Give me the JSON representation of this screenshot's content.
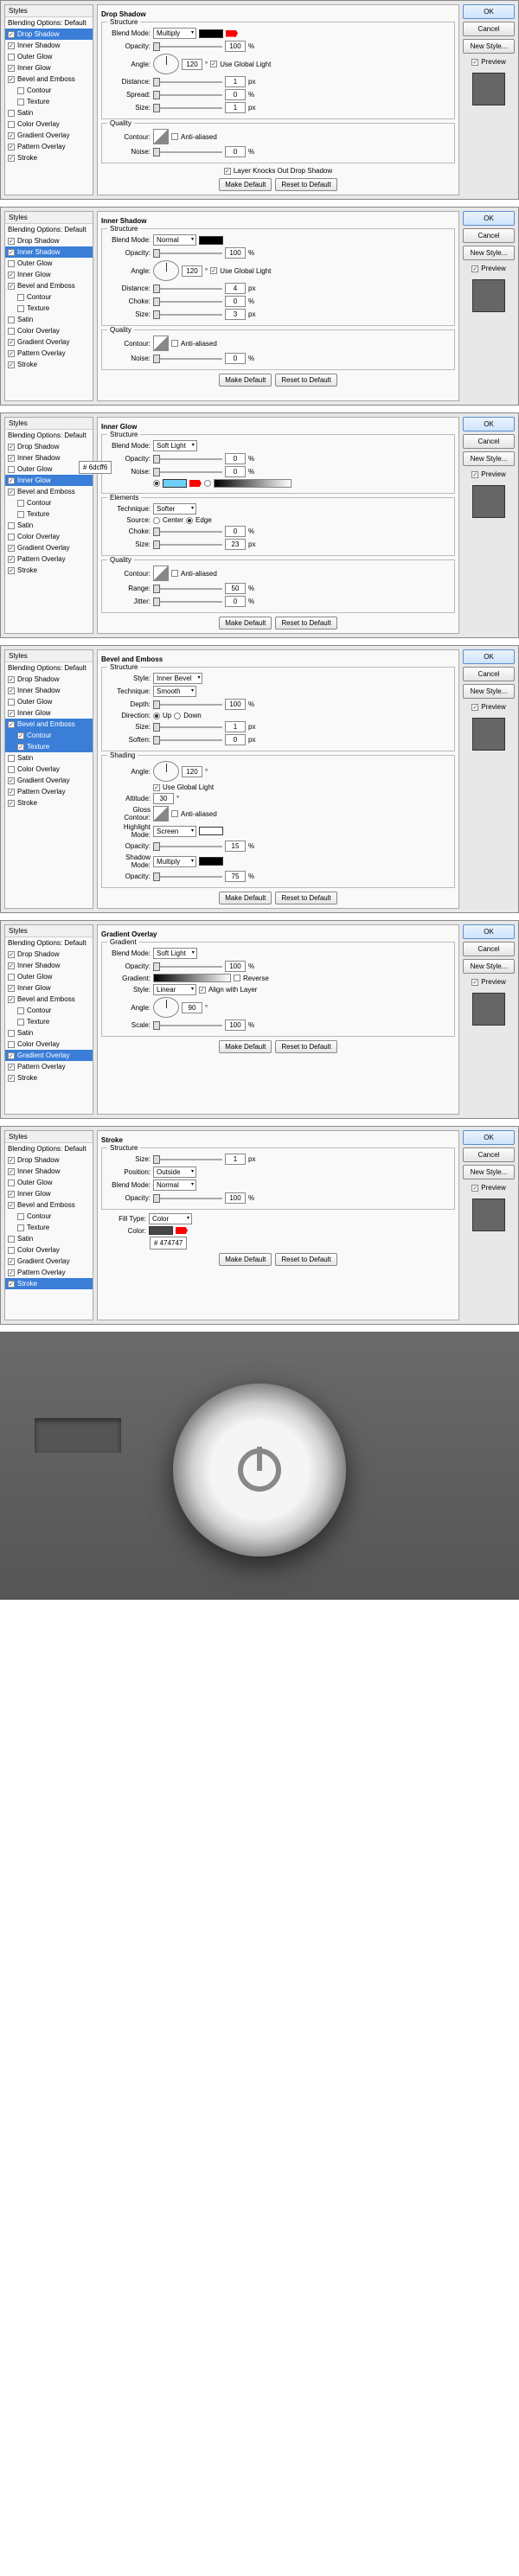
{
  "styleListHeaders": {
    "styles": "Styles",
    "blendingOptions": "Blending Options: Default"
  },
  "styleNames": {
    "dropShadow": "Drop Shadow",
    "innerShadow": "Inner Shadow",
    "outerGlow": "Outer Glow",
    "innerGlow": "Inner Glow",
    "bevelEmboss": "Bevel and Emboss",
    "contour": "Contour",
    "texture": "Texture",
    "satin": "Satin",
    "colorOverlay": "Color Overlay",
    "gradientOverlay": "Gradient Overlay",
    "patternOverlay": "Pattern Overlay",
    "stroke": "Stroke"
  },
  "buttons": {
    "ok": "OK",
    "cancel": "Cancel",
    "newStyle": "New Style...",
    "preview": "Preview",
    "makeDefault": "Make Default",
    "resetDefault": "Reset to Default"
  },
  "labels": {
    "structure": "Structure",
    "quality": "Quality",
    "elements": "Elements",
    "shading": "Shading",
    "gradient": "Gradient",
    "blendMode": "Blend Mode:",
    "opacity": "Opacity:",
    "angle": "Angle:",
    "useGlobalLight": "Use Global Light",
    "distance": "Distance:",
    "spread": "Spread:",
    "size": "Size:",
    "choke": "Choke:",
    "contour": "Contour:",
    "antiAliased": "Anti-aliased",
    "noise": "Noise:",
    "layerKnocksOut": "Layer Knocks Out Drop Shadow",
    "technique": "Technique:",
    "source": "Source:",
    "center": "Center",
    "edge": "Edge",
    "range": "Range:",
    "jitter": "Jitter:",
    "style": "Style:",
    "depth": "Depth:",
    "direction": "Direction:",
    "up": "Up",
    "down": "Down",
    "soften": "Soften:",
    "altitude": "Altitude:",
    "glossContour": "Gloss Contour:",
    "highlightMode": "Highlight Mode:",
    "shadowMode": "Shadow Mode:",
    "gradientLabel": "Gradient:",
    "reverse": "Reverse",
    "alignWithLayer": "Align with Layer",
    "scale": "Scale:",
    "position": "Position:",
    "fillType": "Fill Type:",
    "color": "Color:",
    "px": "px",
    "pct": "%",
    "deg": "°"
  },
  "dialogs": [
    {
      "id": "dropShadow",
      "title": "Drop Shadow",
      "selected": "dropShadow",
      "checked": [
        "dropShadow",
        "innerShadow",
        "innerGlow",
        "bevelEmboss",
        "gradientOverlay",
        "patternOverlay",
        "stroke"
      ],
      "blendMode": "Multiply",
      "opacity": 100,
      "angle": 120,
      "useGlobal": true,
      "distance": 1,
      "spread": 0,
      "size": 1,
      "noise": 0,
      "swatchColor": "#000000"
    },
    {
      "id": "innerShadow",
      "title": "Inner Shadow",
      "selected": "innerShadow",
      "checked": [
        "dropShadow",
        "innerShadow",
        "innerGlow",
        "bevelEmboss",
        "gradientOverlay",
        "patternOverlay",
        "stroke"
      ],
      "blendMode": "Normal",
      "opacity": 100,
      "angle": 120,
      "useGlobal": true,
      "distance": 4,
      "choke": 0,
      "size": 3,
      "noise": 0,
      "swatchColor": "#000000"
    },
    {
      "id": "innerGlow",
      "title": "Inner Glow",
      "selected": "innerGlow",
      "checked": [
        "dropShadow",
        "innerShadow",
        "innerGlow",
        "bevelEmboss",
        "gradientOverlay",
        "patternOverlay",
        "stroke"
      ],
      "blendMode": "Soft Light",
      "opacity": 0,
      "noise": 0,
      "hexTooltip": "# 6dcff6",
      "technique": "Softer",
      "sourceEdge": true,
      "choke": 0,
      "size": 23,
      "range": 50,
      "jitter": 0,
      "swatchColor": "#6dcff6"
    },
    {
      "id": "bevelEmboss",
      "title": "Bevel and Emboss",
      "selected": "bevelEmboss",
      "checked": [
        "dropShadow",
        "innerShadow",
        "innerGlow",
        "bevelEmboss",
        "gradientOverlay",
        "patternOverlay",
        "stroke"
      ],
      "subSelected": [
        "contour",
        "texture"
      ],
      "style": "Inner Bevel",
      "technique": "Smooth",
      "depth": 100,
      "directionUp": true,
      "size": 1,
      "soften": 0,
      "angle": 120,
      "useGlobal": true,
      "altitude": 30,
      "highlightMode": "Screen",
      "highlightOpacity": 15,
      "shadowMode": "Multiply",
      "shadowOpacity": 75
    },
    {
      "id": "gradientOverlay",
      "title": "Gradient Overlay",
      "selected": "gradientOverlay",
      "checked": [
        "dropShadow",
        "innerShadow",
        "innerGlow",
        "bevelEmboss",
        "gradientOverlay",
        "patternOverlay",
        "stroke"
      ],
      "blendMode": "Soft Light",
      "opacity": 100,
      "reverse": false,
      "styleVal": "Linear",
      "alignWithLayer": true,
      "angle": 90,
      "scale": 100
    },
    {
      "id": "stroke",
      "title": "Stroke",
      "selected": "stroke",
      "checked": [
        "dropShadow",
        "innerShadow",
        "innerGlow",
        "bevelEmboss",
        "gradientOverlay",
        "patternOverlay",
        "stroke"
      ],
      "size": 1,
      "position": "Outside",
      "blendMode": "Normal",
      "opacity": 100,
      "fillType": "Color",
      "hexColor": "# 474747",
      "swatchColor": "#474747"
    }
  ]
}
